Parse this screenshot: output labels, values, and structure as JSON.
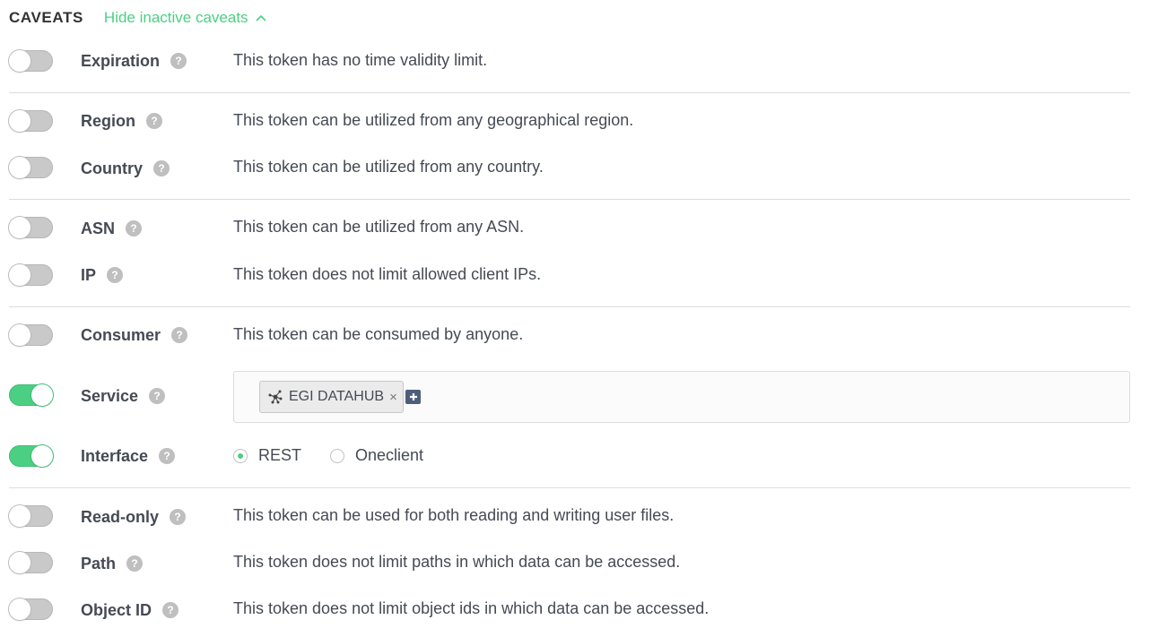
{
  "header": {
    "title": "CAVEATS",
    "hide_link": "Hide inactive caveats"
  },
  "help_glyph": "?",
  "caveats": {
    "expiration": {
      "label": "Expiration",
      "enabled": false,
      "desc": "This token has no time validity limit."
    },
    "region": {
      "label": "Region",
      "enabled": false,
      "desc": "This token can be utilized from any geographical region."
    },
    "country": {
      "label": "Country",
      "enabled": false,
      "desc": "This token can be utilized from any country."
    },
    "asn": {
      "label": "ASN",
      "enabled": false,
      "desc": "This token can be utilized from any ASN."
    },
    "ip": {
      "label": "IP",
      "enabled": false,
      "desc": "This token does not limit allowed client IPs."
    },
    "consumer": {
      "label": "Consumer",
      "enabled": false,
      "desc": "This token can be consumed by anyone."
    },
    "service": {
      "label": "Service",
      "enabled": true,
      "tags": [
        {
          "label": "EGI DATAHUB",
          "icon": "service-network-icon",
          "remove": "×"
        }
      ]
    },
    "interface": {
      "label": "Interface",
      "enabled": true,
      "options": [
        {
          "label": "REST",
          "checked": true
        },
        {
          "label": "Oneclient",
          "checked": false
        }
      ]
    },
    "readonly": {
      "label": "Read-only",
      "enabled": false,
      "desc": "This token can be used for both reading and writing user files."
    },
    "path": {
      "label": "Path",
      "enabled": false,
      "desc": "This token does not limit paths in which data can be accessed."
    },
    "objectid": {
      "label": "Object ID",
      "enabled": false,
      "desc": "This token does not limit object ids in which data can be accessed."
    }
  },
  "colors": {
    "accent": "#4bd083",
    "toggle_off": "#c9c9c9",
    "add_button": "#4e5e7a",
    "text": "#454a54"
  }
}
